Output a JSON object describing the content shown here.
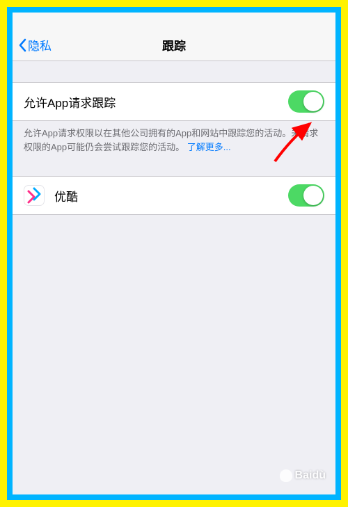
{
  "nav": {
    "back_label": "隐私",
    "title": "跟踪"
  },
  "main_toggle": {
    "label": "允许App请求跟踪",
    "on": true
  },
  "footer": {
    "text": "允许App请求权限以在其他公司拥有的App和网站中跟踪您的活动。未请求权限的App可能仍会尝试跟踪您的活动。",
    "link_text": "了解更多..."
  },
  "apps": [
    {
      "name": "优酷",
      "on": true
    }
  ],
  "watermark": "Baidù"
}
